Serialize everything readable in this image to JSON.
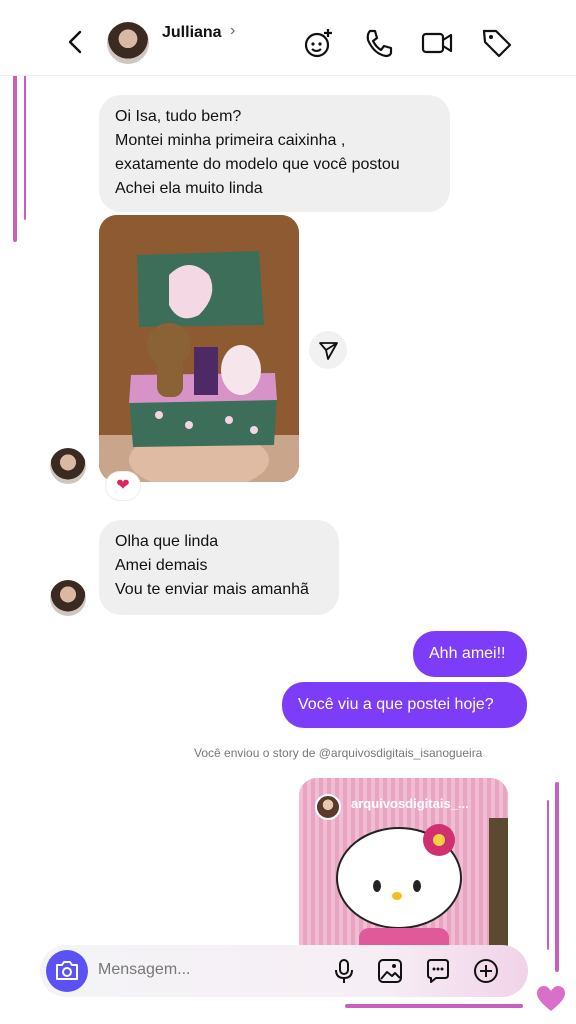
{
  "header": {
    "contact_name": "Julliana",
    "chevron": "›"
  },
  "messages": {
    "first": [
      "Oi Isa, tudo bem?",
      "Montei minha primeira caixinha ,",
      "exatamente do modelo que você postou",
      "Achei ela muito linda"
    ],
    "reaction": "❤",
    "second": [
      "Olha que linda",
      "Amei demais",
      "Vou te enviar mais amanhã"
    ],
    "out1": "Ahh amei!!",
    "out2": "Você viu a que postei hoje?",
    "story_note": "Você enviou o story de @arquivosdigitais_isanogueira",
    "story_username": "arquivosdigitais_..."
  },
  "composer": {
    "placeholder": "Mensagem..."
  },
  "colors": {
    "accent": "#7d3cf8",
    "camera": "#5b52f5",
    "frame": "#c85fc0"
  }
}
